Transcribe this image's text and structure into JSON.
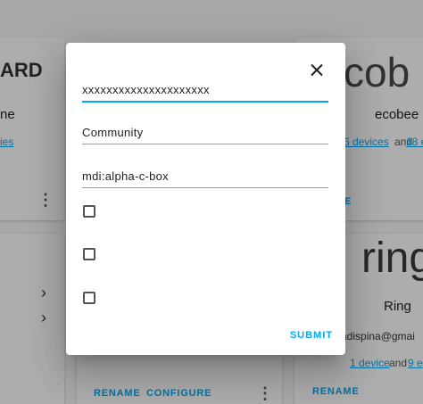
{
  "background": {
    "left_card": {
      "logo_text": "ARD",
      "title_fragment": "ne",
      "link_fragment": "ies"
    },
    "middle_card": {
      "rename_label": "RENAME",
      "configure_label": "CONFIGURE"
    },
    "ecobee_card": {
      "logo_text": "cob",
      "title": "ecobee",
      "devices_link": "6 devices",
      "link_separator": "and",
      "entities_link": "18 e",
      "action_label": "E"
    },
    "ring_card": {
      "logo_text": "ring",
      "title": "Ring",
      "account": "adispina@gmai",
      "devices_link": "1 device",
      "link_separator": "and",
      "entities_link": "9 e",
      "rename_label": "RENAME"
    }
  },
  "dialog": {
    "fields": [
      {
        "value": "xxxxxxxxxxxxxxxxxxxxx",
        "placeholder": ""
      },
      {
        "value": "Community",
        "placeholder": ""
      },
      {
        "value": "mdi:alpha-c-box",
        "placeholder": ""
      }
    ],
    "checkboxes": [
      {
        "checked": false
      },
      {
        "checked": false
      },
      {
        "checked": false
      }
    ],
    "submit_label": "SUBMIT"
  },
  "colors": {
    "accent": "#03a9f4",
    "scrim": "rgba(0,0,0,0.32)"
  }
}
